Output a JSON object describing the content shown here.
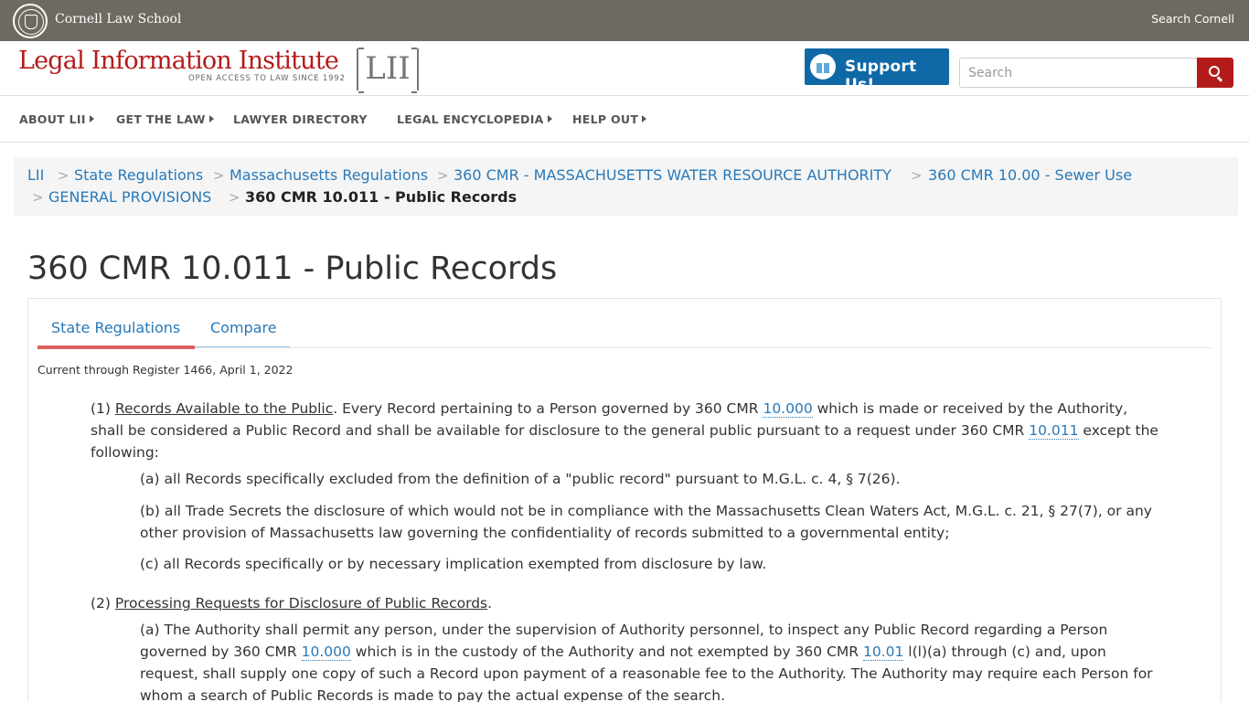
{
  "topbar": {
    "institution": "Cornell Law School",
    "search_cornell": "Search Cornell"
  },
  "header": {
    "logo_title": "Legal Information Institute",
    "logo_tagline": "OPEN ACCESS TO LAW SINCE 1992",
    "logo_mark": "LII",
    "support_label": "Support Us!",
    "search_placeholder": "Search"
  },
  "nav": {
    "items": [
      {
        "label": "ABOUT LII"
      },
      {
        "label": "GET THE LAW"
      },
      {
        "label": "LAWYER DIRECTORY"
      },
      {
        "label": "LEGAL ENCYCLOPEDIA"
      },
      {
        "label": "HELP OUT"
      }
    ]
  },
  "breadcrumb": {
    "items": [
      {
        "label": "LII"
      },
      {
        "label": "State Regulations"
      },
      {
        "label": "Massachusetts Regulations"
      },
      {
        "label": "360 CMR - MASSACHUSETTS WATER RESOURCE AUTHORITY"
      },
      {
        "label": "360 CMR 10.00 - Sewer Use"
      },
      {
        "label": "GENERAL PROVISIONS"
      },
      {
        "label": "360 CMR 10.011 - Public Records"
      }
    ],
    "separator": ">"
  },
  "page": {
    "title": "360 CMR 10.011 - Public Records",
    "tabs": [
      {
        "label": "State Regulations"
      },
      {
        "label": "Compare"
      }
    ],
    "currency": "Current through Register 1466, April 1, 2022"
  },
  "content": {
    "p1": {
      "num": "(1) ",
      "heading": "Records Available to the Public",
      "t1": ". Every Record pertaining to a Person governed by 360 CMR ",
      "ref1": "10.000",
      "t2": " which is made or received by the Authority,",
      "t3": "shall be considered a Public Record and shall be available for disclosure to the general public pursuant to a request under 360 CMR ",
      "ref2": "10.011",
      "t4": " except the",
      "t5": "following:"
    },
    "p1a": "(a) all Records specifically excluded from the definition of a \"public record\" pursuant to M.G.L. c. 4, § 7(26).",
    "p1b_line1": "(b) all Trade Secrets the disclosure of which would not be in compliance with the Massachusetts Clean Waters Act, M.G.L. c. 21, § 27(7), or any",
    "p1b_line2": "other provision of Massachusetts law governing the confidentiality of records submitted to a governmental entity;",
    "p1c": "(c) all Records specifically or by necessary implication exempted from disclosure by law.",
    "p2": {
      "num": "(2) ",
      "heading": "Processing Requests for Disclosure of Public Records",
      "tail": "."
    },
    "p2a": {
      "line1": "(a) The Authority shall permit any person, under the supervision of Authority personnel, to inspect any Public Record regarding a Person",
      "t1": "governed by 360 CMR ",
      "ref1": "10.000",
      "t2": " which is in the custody of the Authority and not exempted by 360 CMR ",
      "ref2": "10.01",
      "t3": " l(l)(a) through (c) and, upon",
      "line3": "request, shall supply one copy of such a Record upon payment of a reasonable fee to the Authority. The Authority may require each Person for",
      "line4": "whom a search of Public Records is made to pay the actual expense of the search."
    }
  },
  "colors": {
    "topbar": "#6f6a61",
    "brand_red": "#b31b1b",
    "link_blue": "#2879b8",
    "support_blue": "#0f69a6",
    "tab_active": "#dc5f5f"
  }
}
